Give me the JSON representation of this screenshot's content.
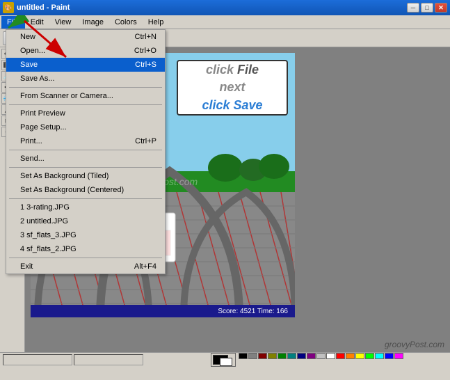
{
  "window": {
    "title": "untitled - Paint",
    "icon": "🎨"
  },
  "title_buttons": {
    "minimize": "─",
    "maximize": "□",
    "close": "✕"
  },
  "menu_bar": {
    "items": [
      {
        "label": "File",
        "active": true
      },
      {
        "label": "Edit",
        "active": false
      },
      {
        "label": "View",
        "active": false
      },
      {
        "label": "Image",
        "active": false
      },
      {
        "label": "Colors",
        "active": false
      },
      {
        "label": "Help",
        "active": false
      }
    ]
  },
  "file_menu": {
    "items": [
      {
        "label": "New",
        "shortcut": "Ctrl+N",
        "selected": false,
        "separator_after": false
      },
      {
        "label": "Open...",
        "shortcut": "Ctrl+O",
        "selected": false,
        "separator_after": false
      },
      {
        "label": "Save",
        "shortcut": "Ctrl+S",
        "selected": true,
        "separator_after": false
      },
      {
        "label": "Save As...",
        "shortcut": "",
        "selected": false,
        "separator_after": true
      },
      {
        "label": "From Scanner or Camera...",
        "shortcut": "",
        "selected": false,
        "separator_after": true
      },
      {
        "label": "Print Preview",
        "shortcut": "",
        "selected": false,
        "separator_after": false
      },
      {
        "label": "Page Setup...",
        "shortcut": "",
        "selected": false,
        "separator_after": false
      },
      {
        "label": "Print...",
        "shortcut": "Ctrl+P",
        "selected": false,
        "separator_after": true
      },
      {
        "label": "Send...",
        "shortcut": "",
        "selected": false,
        "separator_after": true
      },
      {
        "label": "Set As Background (Tiled)",
        "shortcut": "",
        "selected": false,
        "separator_after": false
      },
      {
        "label": "Set As Background (Centered)",
        "shortcut": "",
        "selected": false,
        "separator_after": true
      },
      {
        "label": "1 3-rating.JPG",
        "shortcut": "",
        "selected": false,
        "separator_after": false
      },
      {
        "label": "2 untitled.JPG",
        "shortcut": "",
        "selected": false,
        "separator_after": false
      },
      {
        "label": "3 sf_flats_3.JPG",
        "shortcut": "",
        "selected": false,
        "separator_after": false
      },
      {
        "label": "4 sf_flats_2.JPG",
        "shortcut": "",
        "selected": false,
        "separator_after": true
      },
      {
        "label": "Exit",
        "shortcut": "Alt+F4",
        "selected": false,
        "separator_after": false
      }
    ]
  },
  "canvas": {
    "text_box": {
      "line1": "click File",
      "line2": "next",
      "line3": "click Save"
    },
    "score": "Score: 4521  Time: 166"
  },
  "status_bar": {
    "coords": "",
    "size": ""
  },
  "watermark": "groovyPost.com",
  "colors": {
    "swatches": [
      "#000000",
      "#808080",
      "#800000",
      "#808000",
      "#008000",
      "#008080",
      "#000080",
      "#800080",
      "#808040",
      "#004040",
      "#0080FF",
      "#004080",
      "#8000FF",
      "#804000",
      "#FF0000",
      "#FF8000",
      "#FFFF00",
      "#80FF00",
      "#00FF00",
      "#00FF80",
      "#00FFFF",
      "#0080FF",
      "#0000FF",
      "#8000FF",
      "#FF00FF",
      "#FF0080",
      "#FFFFFF",
      "#C0C0C0",
      "#FF8080",
      "#FFFF80",
      "#80FF80",
      "#00FFFF"
    ]
  }
}
